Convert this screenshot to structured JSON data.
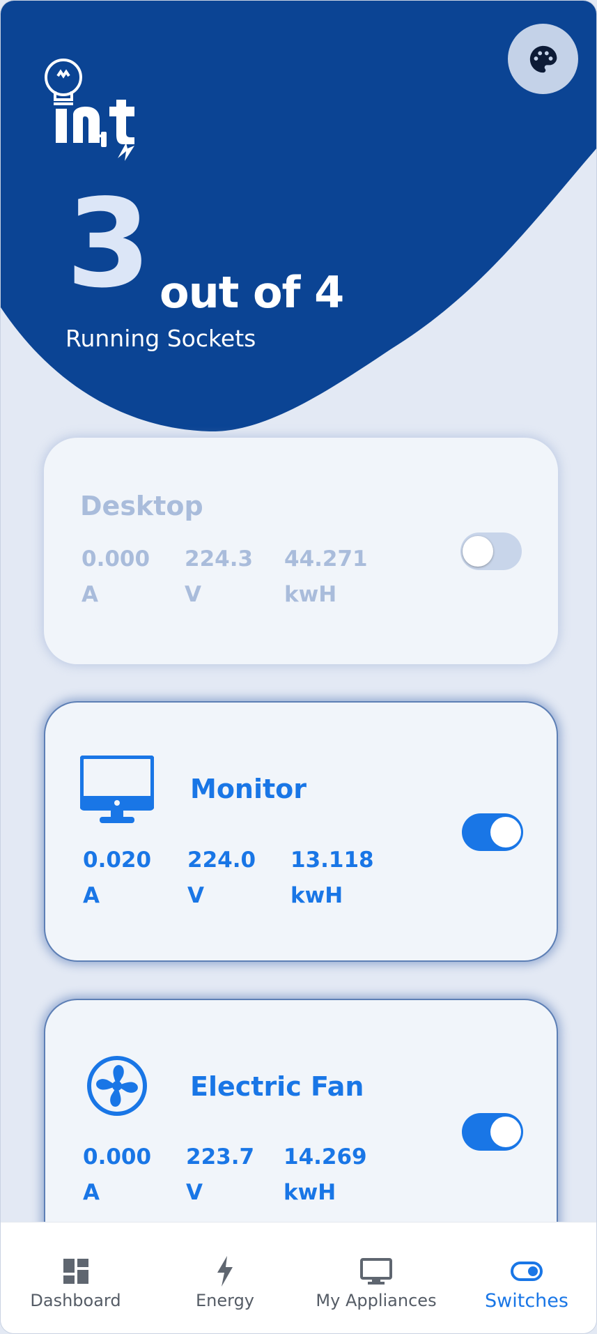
{
  "hero": {
    "running_count": "3",
    "total_text": "out of 4",
    "label": "Running Sockets",
    "logo_text": "int"
  },
  "icons": {
    "palette": "palette-icon",
    "logo": "lightbulb-plug-logo"
  },
  "sockets": [
    {
      "name": "Desktop",
      "current": "0.000",
      "current_unit": "A",
      "voltage": "224.3",
      "voltage_unit": "V",
      "energy": "44.271",
      "energy_unit": "kwH",
      "on": false,
      "icon": "none"
    },
    {
      "name": "Monitor",
      "current": "0.020",
      "current_unit": "A",
      "voltage": "224.0",
      "voltage_unit": "V",
      "energy": "13.118",
      "energy_unit": "kwH",
      "on": true,
      "icon": "monitor-icon"
    },
    {
      "name": "Electric Fan",
      "current": "0.000",
      "current_unit": "A",
      "voltage": "223.7",
      "voltage_unit": "V",
      "energy": "14.269",
      "energy_unit": "kwH",
      "on": true,
      "icon": "fan-icon"
    }
  ],
  "nav": {
    "items": [
      {
        "label": "Dashboard",
        "icon": "dashboard-icon"
      },
      {
        "label": "Energy",
        "icon": "lightning-icon"
      },
      {
        "label": "My Appliances",
        "icon": "monitor-icon"
      },
      {
        "label": "Switches",
        "icon": "toggle-icon",
        "active": true
      }
    ]
  },
  "colors": {
    "primary": "#0b4494",
    "accent": "#1976e6",
    "background": "#e3e9f4",
    "card": "#f1f5fa",
    "muted": "#a9bcdb"
  }
}
